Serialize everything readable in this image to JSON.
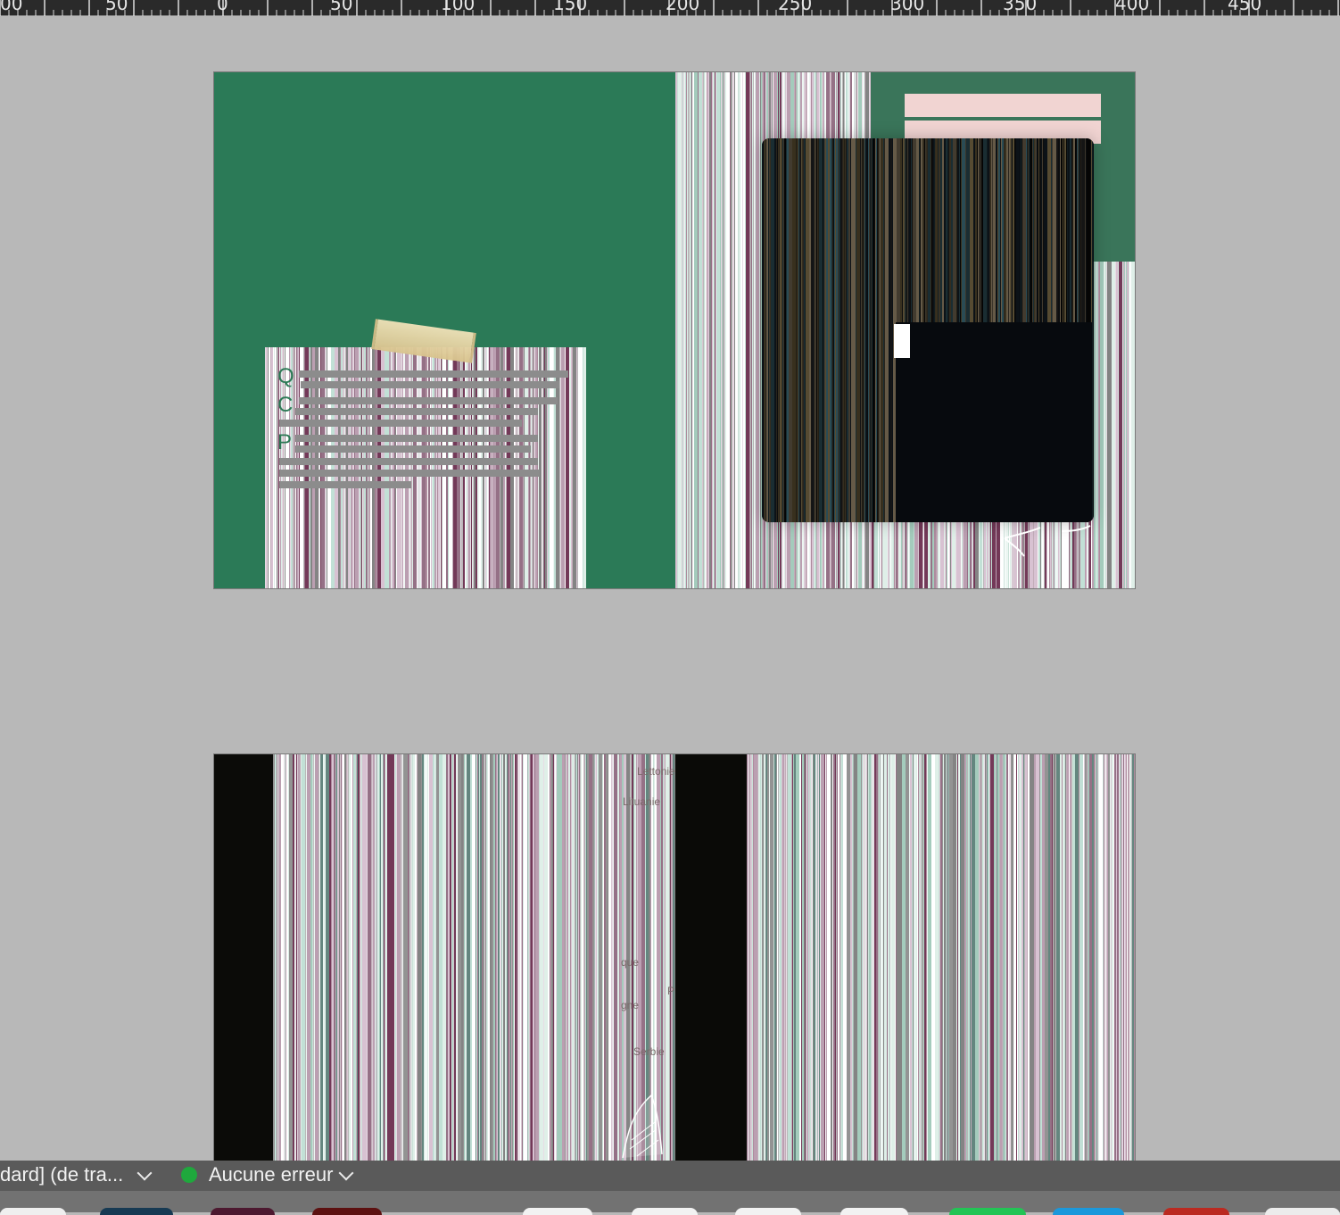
{
  "ruler": {
    "labels": [
      "00",
      "50",
      "0",
      "50",
      "100",
      "150",
      "200",
      "250",
      "300",
      "350",
      "400",
      "450"
    ]
  },
  "top_spread": {
    "left_page": {
      "note_letters": [
        "Q",
        "C",
        "P"
      ]
    },
    "right_page": {}
  },
  "bottom_spread": {
    "labels": [
      "Lettonie",
      "Lituanie",
      "que",
      "gne",
      "Serbie",
      "P"
    ]
  },
  "status_bar": {
    "document_mode": "dard] (de tra...",
    "error_status": "Aucune erreur"
  },
  "colors": {
    "accent_green": "#2b7a57",
    "soft_green": "#5d8b6a",
    "pink": "#f1d4d2",
    "dark_text": "#2d7a56"
  },
  "icons": [
    "chevron-down-icon",
    "status-ok-icon"
  ]
}
